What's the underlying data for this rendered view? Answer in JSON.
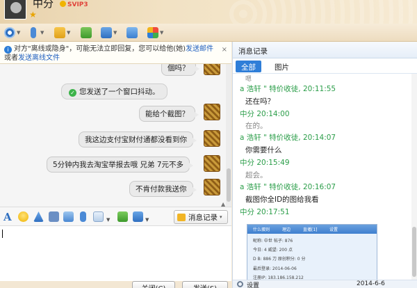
{
  "header": {
    "nickname": "中分",
    "badge": "SVIP3"
  },
  "notice": {
    "line1_prefix": "对方\"离线或隐身\"，可能无法立即回复，您可以给他(她)",
    "send_mail_link": "发送邮件",
    "line2_prefix": "或者",
    "send_offline_file_link": "发送离线文件",
    "close": "×"
  },
  "chat": {
    "partial_top": "個吗？",
    "system_msg": "您发送了一个窗口抖动。",
    "messages": [
      "能给个截图？",
      "我这边支付宝财付通都没看到你",
      "5分钟内我去淘宝举报去哦 兄弟 7元不多",
      "不肯付款我送你"
    ]
  },
  "input_tools": {
    "msg_record_label": "消息记录",
    "caret": "▾"
  },
  "send": {
    "close_label": "关闭(C)",
    "send_label": "发送(S)"
  },
  "right_panel": {
    "title": "消息记录",
    "tabs": [
      "全部",
      "图片"
    ],
    "records": [
      {
        "head": "a     浩轩 \" 特价收徒, 20:11:55",
        "body": "还在吗？",
        "dim": false
      },
      {
        "head": "中分  20:14:00",
        "body": "在的。",
        "dim": true
      },
      {
        "head": "a     浩轩 \" 特价收徒, 20:14:07",
        "body": "你需要什么",
        "dim": false
      },
      {
        "head": "中分  20:15:49",
        "body": "超会。",
        "dim": true
      },
      {
        "head": "a     浩轩 \" 特价收徒, 20:16:07",
        "body": "截图你全ID的图给我看",
        "dim": false
      },
      {
        "head": "中分  20:17:51",
        "body": "",
        "dim": false
      }
    ],
    "partial_top": "嗯",
    "screenshot": {
      "tabs": [
        "什么蛋则",
        "理边",
        "直播[1]",
        "设置"
      ],
      "lines": [
        "昵称:  中世         帖子: 876",
        "今日: 4             威望: 200 点",
        "D B: 886 刀         原创积分: 0 分",
        "最后登录: 2014-06-06",
        "注册IP: 183.186.158.212"
      ]
    },
    "bottom_settings": "设置",
    "bottom_date": "2014-6-6"
  },
  "colors": {
    "accent_blue": "#2f7ed8",
    "record_green": "#2a9d48",
    "header_tan": "#e8d2ac"
  }
}
